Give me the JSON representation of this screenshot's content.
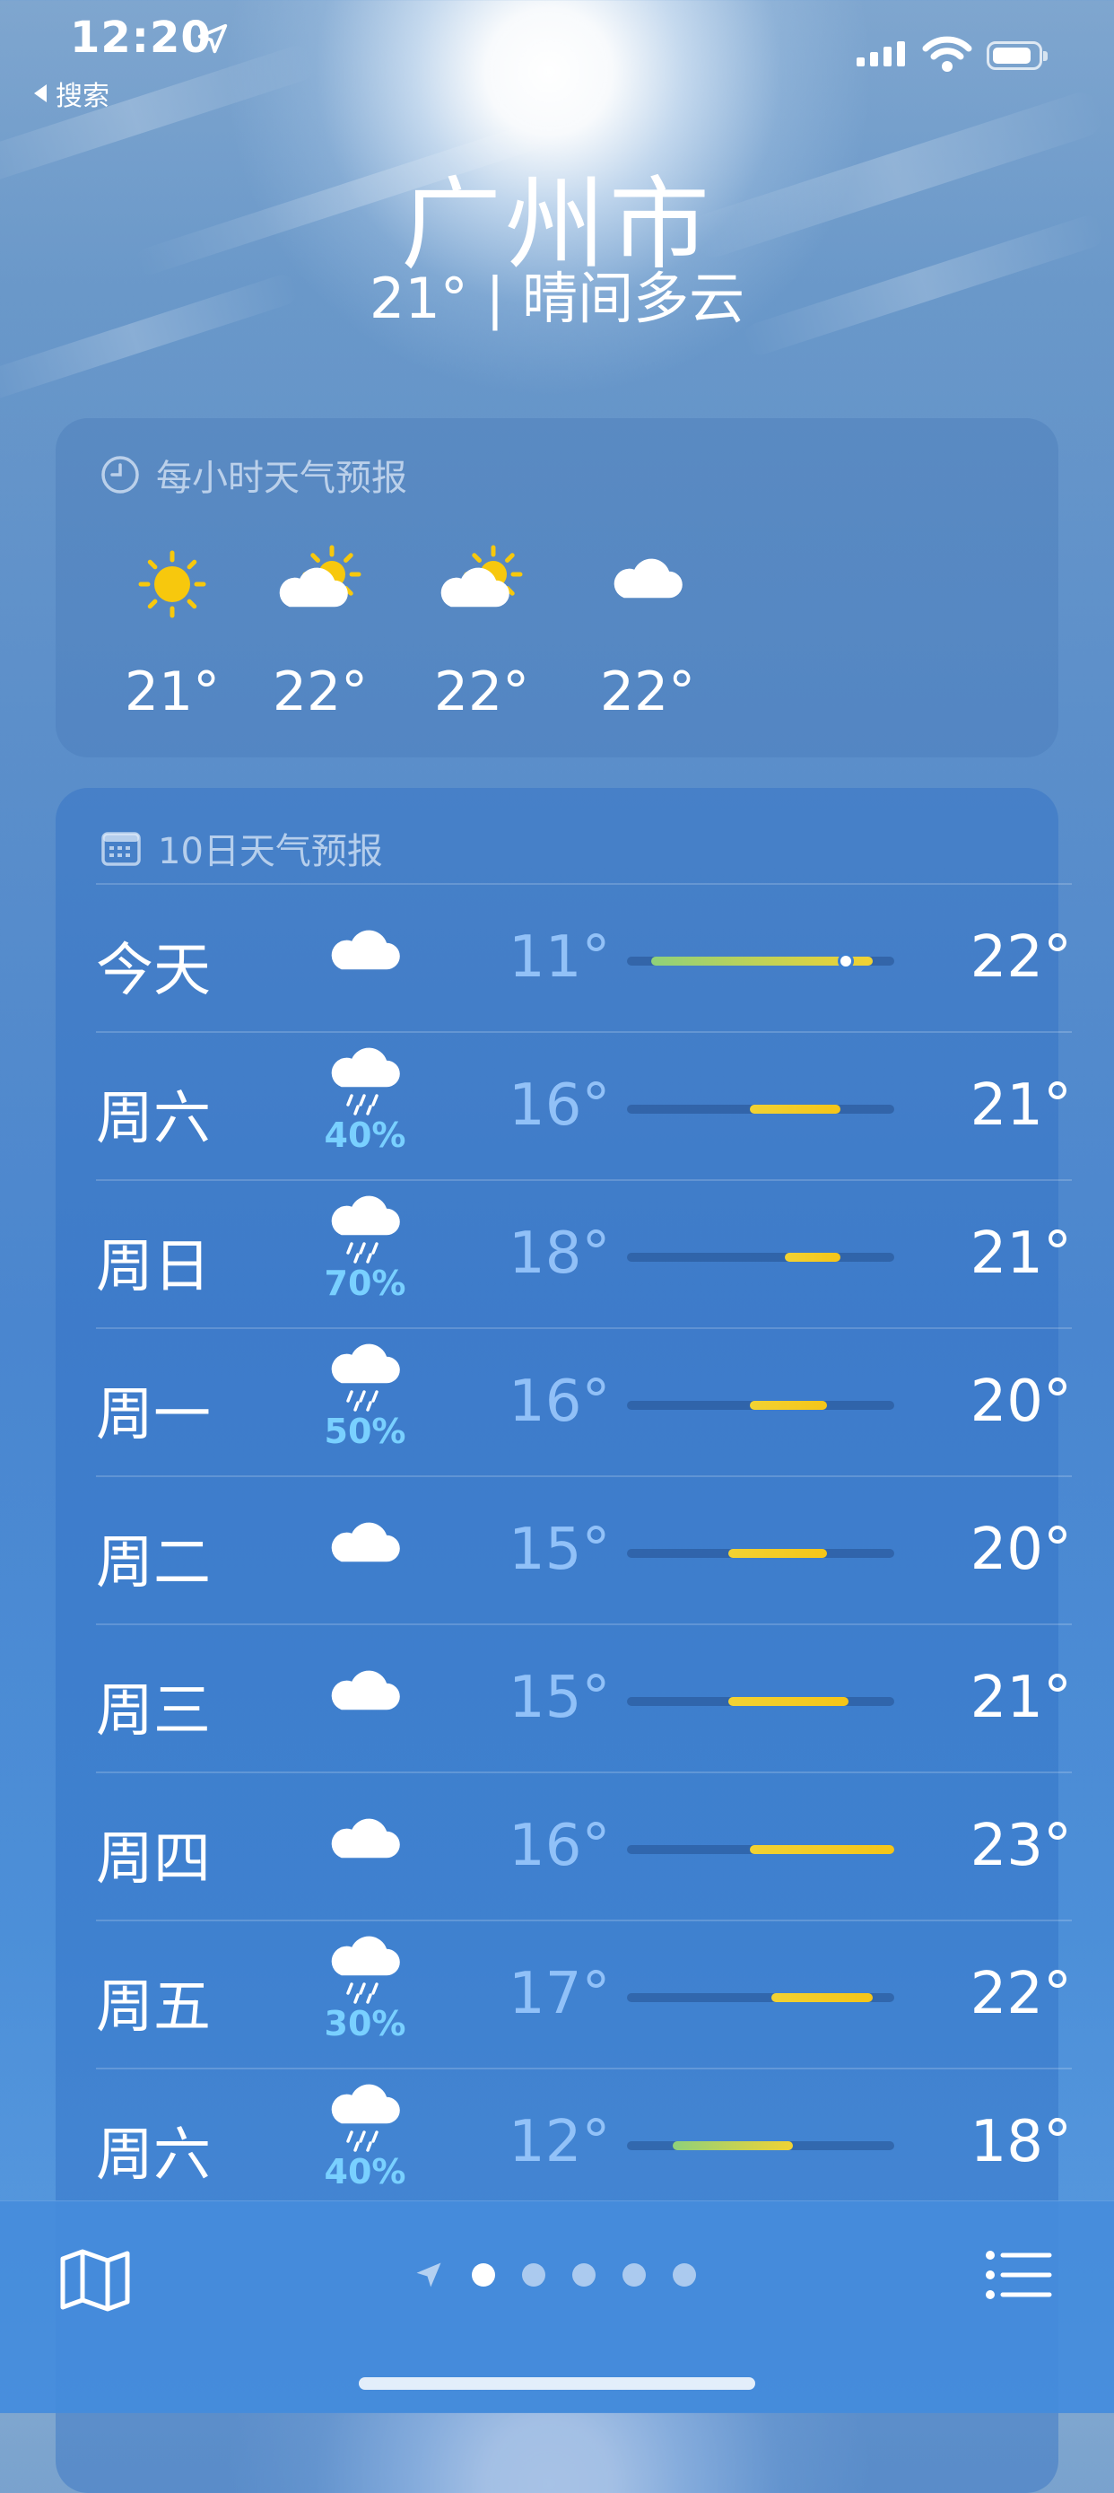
{
  "status_bar": {
    "time": "12:20",
    "back_label": "搜索"
  },
  "location": {
    "city": "广州市",
    "summary": "21° | 晴间多云"
  },
  "hourly": {
    "title": "每小时天气预报",
    "items": [
      {
        "icon": "sun-icon",
        "temp": "21°"
      },
      {
        "icon": "partly-cloudy-icon",
        "temp": "22°"
      },
      {
        "icon": "partly-cloudy-icon",
        "temp": "22°"
      },
      {
        "icon": "cloud-icon",
        "temp": "22°"
      }
    ]
  },
  "daily": {
    "title": "10日天气预报",
    "days": [
      {
        "day": "今天",
        "icon": "cloud-icon",
        "precip": "",
        "low": "11°",
        "high": "22°",
        "range_start": 0.09,
        "range_end": 0.92,
        "current_marker": 0.82
      },
      {
        "day": "周六",
        "icon": "rain-icon",
        "precip": "40%",
        "low": "16°",
        "high": "21°",
        "range_start": 0.46,
        "range_end": 0.8
      },
      {
        "day": "周日",
        "icon": "rain-icon",
        "precip": "70%",
        "low": "18°",
        "high": "21°",
        "range_start": 0.59,
        "range_end": 0.8
      },
      {
        "day": "周一",
        "icon": "rain-icon",
        "precip": "50%",
        "low": "16°",
        "high": "20°",
        "range_start": 0.46,
        "range_end": 0.75
      },
      {
        "day": "周二",
        "icon": "cloud-icon",
        "precip": "",
        "low": "15°",
        "high": "20°",
        "range_start": 0.38,
        "range_end": 0.75
      },
      {
        "day": "周三",
        "icon": "cloud-icon",
        "precip": "",
        "low": "15°",
        "high": "21°",
        "range_start": 0.38,
        "range_end": 0.83
      },
      {
        "day": "周四",
        "icon": "cloud-icon",
        "precip": "",
        "low": "16°",
        "high": "23°",
        "range_start": 0.46,
        "range_end": 1.0
      },
      {
        "day": "周五",
        "icon": "rain-icon",
        "precip": "30%",
        "low": "17°",
        "high": "22°",
        "range_start": 0.54,
        "range_end": 0.92
      },
      {
        "day": "周六",
        "icon": "rain-icon",
        "precip": "40%",
        "low": "12°",
        "high": "18°",
        "range_start": 0.17,
        "range_end": 0.62
      }
    ]
  },
  "colors": {
    "bar_cool": "#8fd17a",
    "bar_warm": "#f2d233",
    "bar_hot": "#f5c518",
    "precip": "#79d0ff"
  },
  "bottom_bar": {
    "page_count": 5,
    "active_page": 0
  }
}
